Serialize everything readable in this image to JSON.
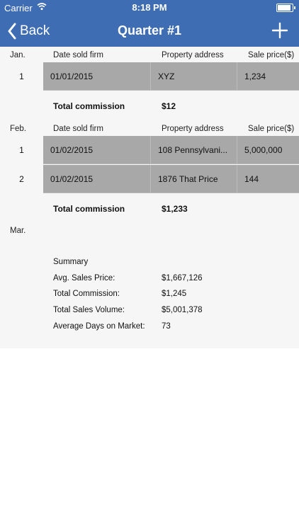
{
  "status_bar": {
    "carrier": "Carrier",
    "time": "8:18 PM"
  },
  "nav": {
    "back_label": "Back",
    "title": "Quarter #1"
  },
  "columns": {
    "date": "Date sold firm",
    "address": "Property address",
    "price": "Sale price($)"
  },
  "months": [
    {
      "label": "Jan.",
      "rows": [
        {
          "index": "1",
          "date": "01/01/2015",
          "address": "XYZ",
          "price": "1,234"
        }
      ],
      "total_label": "Total commission",
      "total_value": "$12"
    },
    {
      "label": "Feb.",
      "rows": [
        {
          "index": "1",
          "date": "01/02/2015",
          "address": "108 Pennsylvani...",
          "price": "5,000,000"
        },
        {
          "index": "2",
          "date": "01/02/2015",
          "address": "1876 That Price",
          "price": "144"
        }
      ],
      "total_label": "Total commission",
      "total_value": "$1,233"
    },
    {
      "label": "Mar."
    }
  ],
  "summary": {
    "title": "Summary",
    "items": [
      {
        "label": "Avg. Sales Price:",
        "value": "$1,667,126"
      },
      {
        "label": "Total Commission:",
        "value": "$1,245"
      },
      {
        "label": "Total Sales Volume:",
        "value": "$5,001,378"
      },
      {
        "label": "Average Days on Market:",
        "value": "73"
      }
    ]
  },
  "colors": {
    "header": "#3f6db3",
    "cell": "#a8a8a8",
    "content_bg": "#f6f6f6"
  },
  "icons": {
    "back": "chevron-left-icon",
    "add": "plus-icon",
    "wifi": "wifi-icon",
    "battery": "battery-icon"
  }
}
